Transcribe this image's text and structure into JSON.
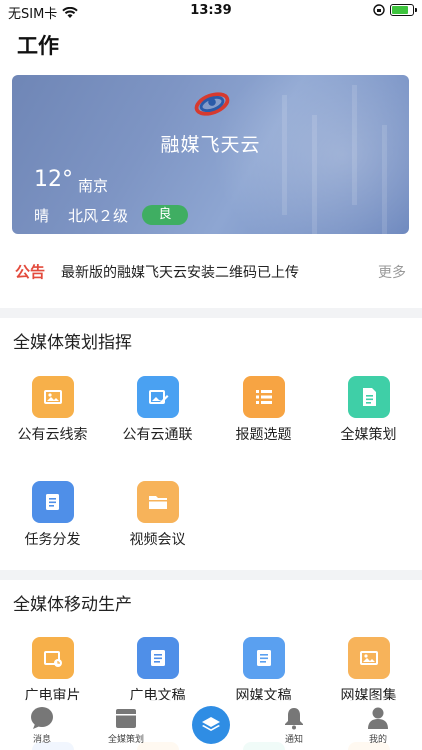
{
  "status": {
    "carrier": "无SIM卡",
    "time": "13:39",
    "battery_level": 0.85
  },
  "page_title": "工作",
  "banner": {
    "name": "融媒飞天云",
    "temperature": "12°",
    "city": "南京",
    "condition": "晴",
    "wind": "北风２级",
    "aqi": "良"
  },
  "notice": {
    "tag": "公告",
    "text": "最新版的融媒飞天云安装二维码已上传",
    "more": "更多"
  },
  "sections": [
    {
      "title": "全媒体策划指挥",
      "items": [
        {
          "label": "公有云线索",
          "icon": "image-icon",
          "color": "#f7b04a"
        },
        {
          "label": "公有云通联",
          "icon": "image-edit-icon",
          "color": "#4aa1f2"
        },
        {
          "label": "报题选题",
          "icon": "list-icon",
          "color": "#f7a443"
        },
        {
          "label": "全媒策划",
          "icon": "document-icon",
          "color": "#3fcfa7"
        },
        {
          "label": "任务分发",
          "icon": "task-icon",
          "color": "#4f8fe8"
        },
        {
          "label": "视频会议",
          "icon": "folder-icon",
          "color": "#f7b35a"
        }
      ]
    },
    {
      "title": "全媒体移动生产",
      "items": [
        {
          "label": "广电审片",
          "icon": "video-review-icon",
          "color": "#f7b04a"
        },
        {
          "label": "广电文稿",
          "icon": "manuscript-icon",
          "color": "#4f8fe8"
        },
        {
          "label": "网媒文稿",
          "icon": "web-manuscript-icon",
          "color": "#5aa0f0"
        },
        {
          "label": "网媒图集",
          "icon": "gallery-icon",
          "color": "#f7b35a"
        }
      ]
    }
  ],
  "tabbar": [
    {
      "label": "消息",
      "icon": "message-icon"
    },
    {
      "label": "全媒策划",
      "icon": "calendar-icon"
    },
    {
      "label": "",
      "icon": "layers-icon"
    },
    {
      "label": "通知",
      "icon": "bell-icon"
    },
    {
      "label": "我的",
      "icon": "user-icon"
    }
  ]
}
